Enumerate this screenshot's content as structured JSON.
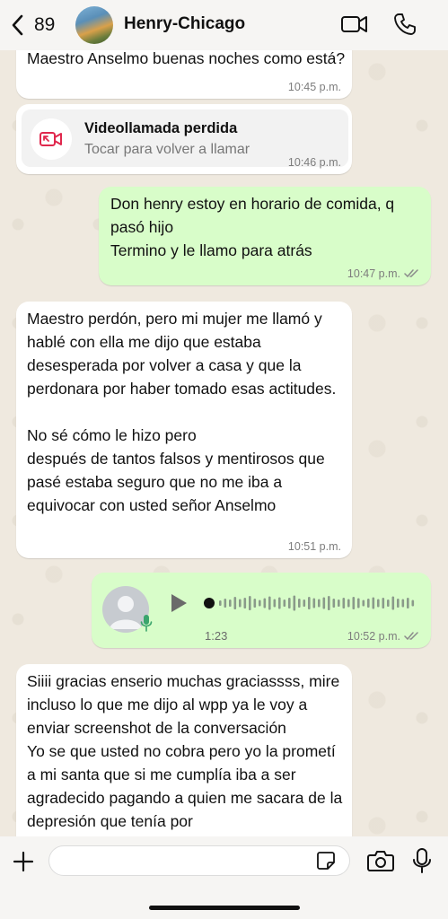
{
  "header": {
    "back_count": "89",
    "contact_name": "Henry-Chicago"
  },
  "messages": [
    {
      "direction": "in",
      "text": "Maestro Anselmo buenas noches como está?",
      "time": "10:45 p.m."
    },
    {
      "direction": "in",
      "type": "missed_call",
      "title": "Videollamada perdida",
      "subtitle": "Tocar para volver a llamar",
      "time": "10:46 p.m."
    },
    {
      "direction": "out",
      "text": "Don henry estoy en horario de comida, q pasó hijo\nTermino y le llamo para atrás",
      "time": "10:47 p.m.",
      "status": "read"
    },
    {
      "direction": "in",
      "text": "Maestro perdón, pero mi mujer  me llamó y hablé con ella me dijo que estaba desesperada por volver a casa y que la perdonara por haber tomado esas actitudes.\n\nNo sé cómo le hizo pero\ndespués de tantos falsos y mentirosos que pasé estaba seguro que no me iba a equivocar con usted señor Anselmo",
      "time": "10:51 p.m."
    },
    {
      "direction": "out",
      "type": "voice",
      "duration": "1:23",
      "time": "10:52 p.m.",
      "status": "read"
    },
    {
      "direction": "in",
      "text": "Siiii gracias enserio muchas graciassss, mire incluso lo que me dijo al wpp ya le voy a enviar screenshot de la conversación\nYo se que usted no cobra pero yo la prometí a mi santa que si me cumplía iba a ser agradecido pagando a quien me sacara de la depresión que tenía por"
    }
  ],
  "composer": {
    "value": "",
    "placeholder": ""
  },
  "colors": {
    "outgoing_bubble": "#d8fdc9",
    "incoming_bubble": "#ffffff",
    "missed_call_red": "#e0284d",
    "ticks": "#8b8b8b"
  }
}
